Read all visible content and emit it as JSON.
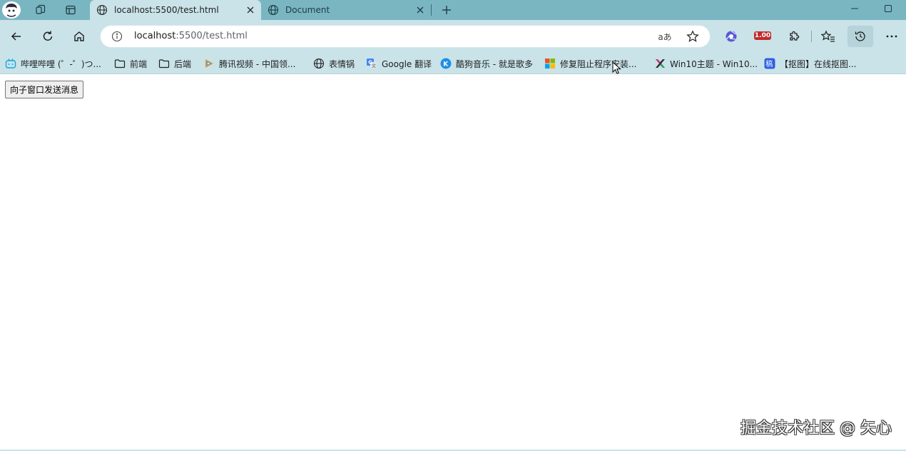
{
  "colors": {
    "tabstrip": "#7ab6c2",
    "toolbar": "#c9e3e8",
    "active_tab": "#c9e3e8",
    "speed_badge": "#c22c2c"
  },
  "tabs": [
    {
      "title": "localhost:5500/test.html",
      "active": true,
      "icon": "globe-icon"
    },
    {
      "title": "Document",
      "active": false,
      "icon": "globe-icon"
    }
  ],
  "address_bar": {
    "host": "localhost",
    "path": ":5500/test.html",
    "read_aloud_label": "aあ"
  },
  "extensions": {
    "speed_badge": "1.00"
  },
  "bookmarks": [
    {
      "label": "哔哩哔哩 (゜-゜)つ...",
      "icon": "bilibili-icon"
    },
    {
      "label": "前端",
      "icon": "folder-icon"
    },
    {
      "label": "后端",
      "icon": "folder-icon"
    },
    {
      "label": "腾讯视频 - 中国领...",
      "icon": "tencent-video-icon"
    },
    {
      "label": "表情锅",
      "icon": "globe-icon"
    },
    {
      "label": "Google 翻译",
      "icon": "google-translate-icon"
    },
    {
      "label": "酷狗音乐 - 就是歌多",
      "icon": "kugou-icon"
    },
    {
      "label": "修复阻止程序安装...",
      "icon": "microsoft-icon"
    },
    {
      "label": "Win10主题 - Win10...",
      "icon": "win10-theme-icon"
    },
    {
      "label": "【抠图】在线抠图...",
      "icon": "koutu-icon"
    }
  ],
  "page": {
    "send_button_label": "向子窗口发送消息"
  },
  "watermark": "掘金技术社区 @ 矢心"
}
